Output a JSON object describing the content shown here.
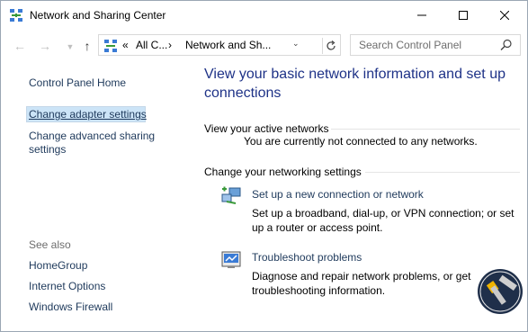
{
  "window": {
    "title": "Network and Sharing Center"
  },
  "address": {
    "overflow": "«",
    "crumbs": [
      "All C...",
      "Network and Sh..."
    ],
    "separator": "›"
  },
  "search": {
    "placeholder": "Search Control Panel"
  },
  "sidebar": {
    "home": "Control Panel Home",
    "items": [
      "Change adapter settings",
      "Change advanced sharing",
      "settings"
    ],
    "see_also_label": "See also",
    "see_also": [
      "HomeGroup",
      "Internet Options",
      "Windows Firewall"
    ]
  },
  "main": {
    "title_line1": "View your basic network information and set up",
    "title_line2": "connections",
    "active_networks_label": "View your active networks",
    "active_networks_status": "You are currently not connected to any networks.",
    "change_settings_label": "Change your networking settings",
    "tasks": [
      {
        "link": "Set up a new connection or network",
        "desc1": "Set up a broadband, dial-up, or VPN connection; or set",
        "desc2": "up a router or access point."
      },
      {
        "link": "Troubleshoot problems",
        "desc1": "Diagnose and repair network problems, or get",
        "desc2": "troubleshooting information."
      }
    ]
  },
  "colors": {
    "link": "#1e395b",
    "title": "#1e3287",
    "selected": "#cce4f7"
  }
}
